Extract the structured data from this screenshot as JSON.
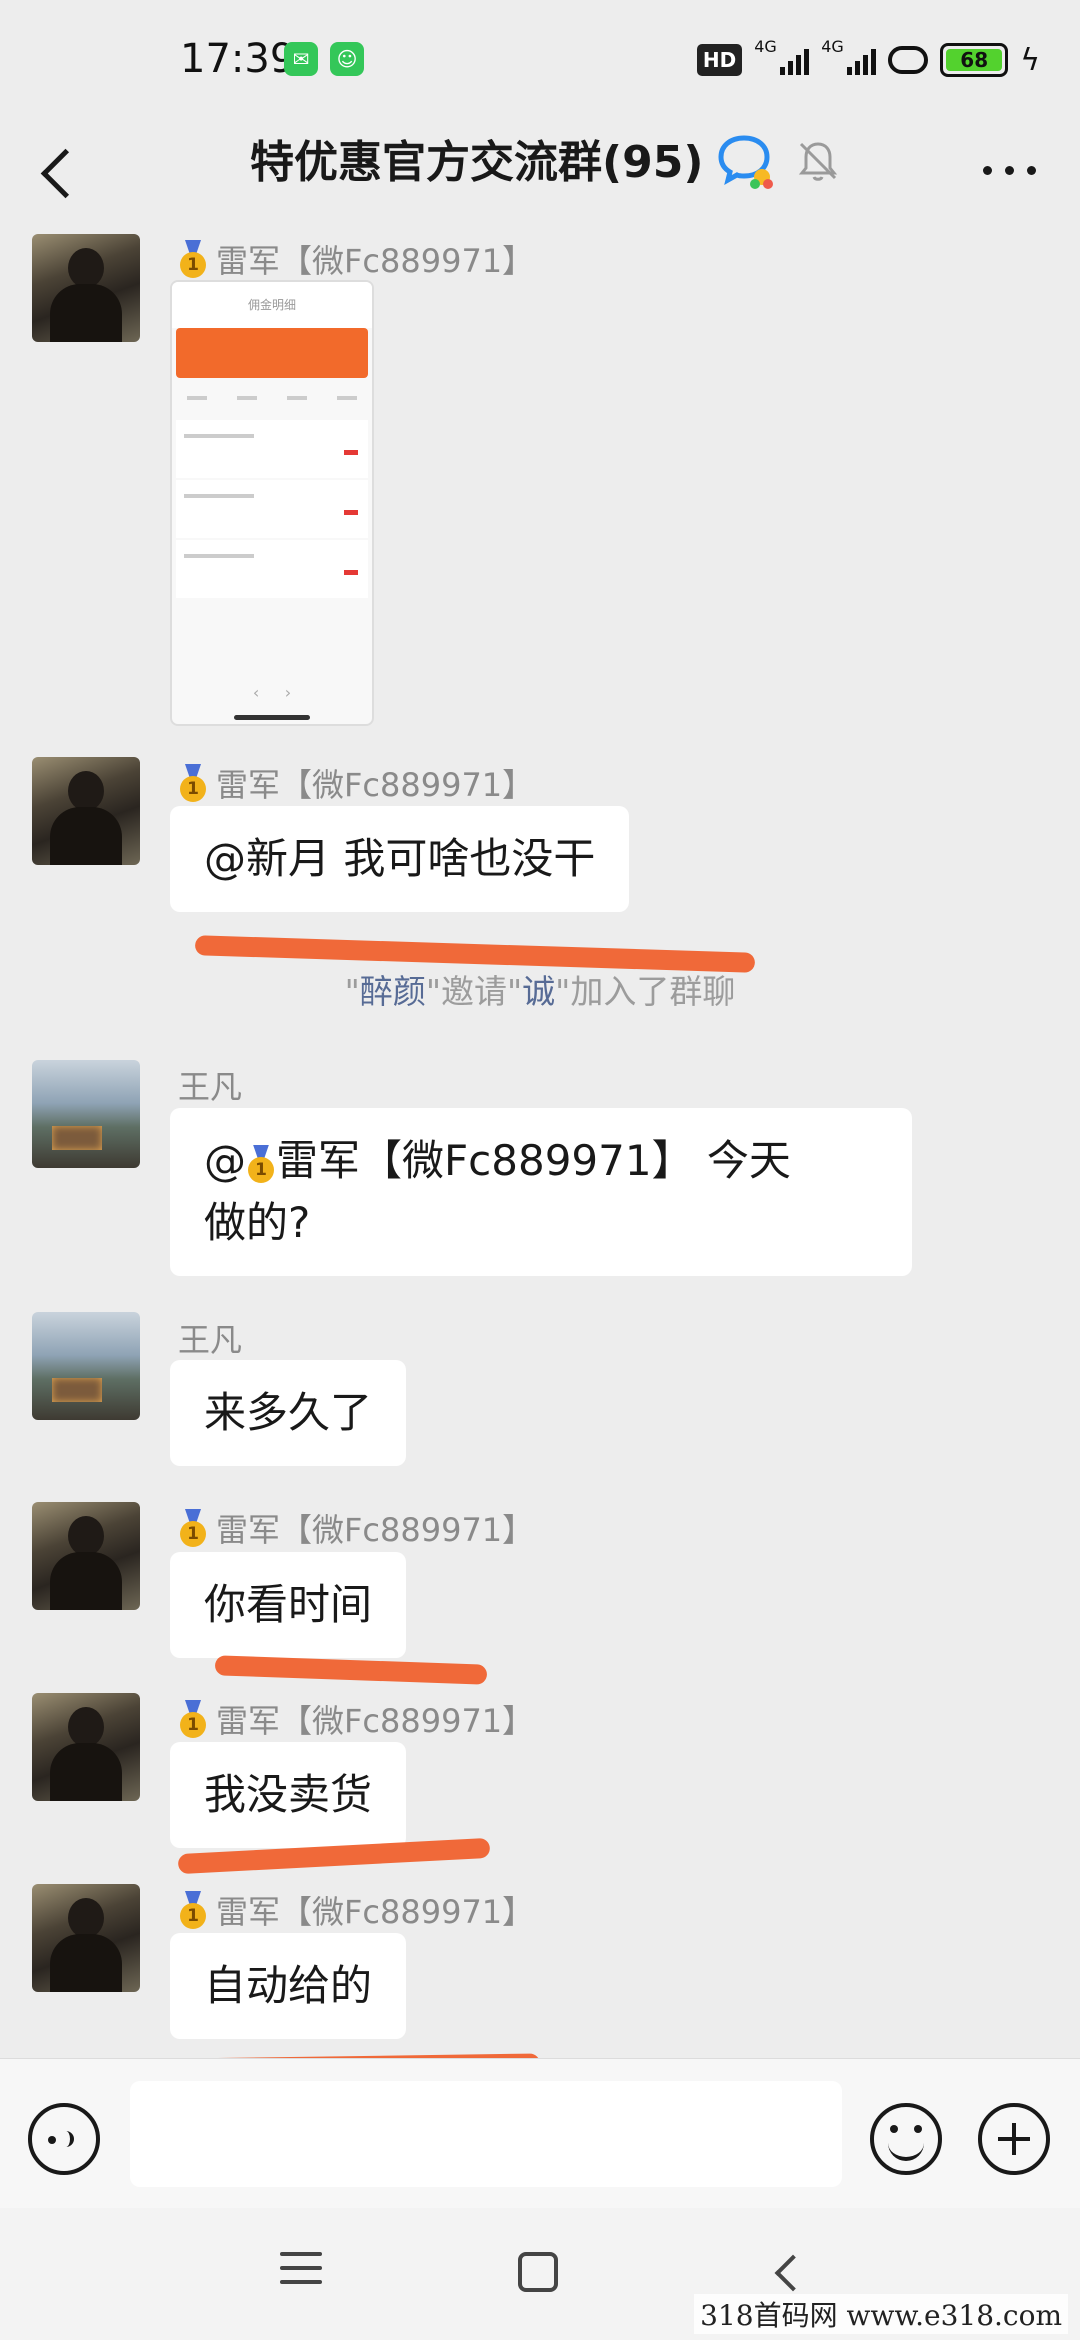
{
  "status_bar": {
    "time": "17:39",
    "hd_label": "HD",
    "network_1": "4G",
    "network_2": "4G",
    "battery_level": "68"
  },
  "header": {
    "title": "特优惠官方交流群(95)"
  },
  "senders": {
    "lei": "雷军【微Fc889971】",
    "wang": "王凡"
  },
  "messages": [
    {
      "sender": "lei",
      "type": "image",
      "image_title": "佣金明细"
    },
    {
      "sender": "lei",
      "type": "text",
      "text": "@新月  我可啥也没干"
    },
    {
      "sender": "wang",
      "type": "text",
      "text_prefix": "@",
      "text_main": "雷军【微Fc889971】 今天",
      "text_line2": "做的?"
    },
    {
      "sender": "wang",
      "type": "text",
      "text": "来多久了"
    },
    {
      "sender": "lei",
      "type": "text",
      "text": "你看时间"
    },
    {
      "sender": "lei",
      "type": "text",
      "text": "我没卖货"
    },
    {
      "sender": "lei",
      "type": "text",
      "text": "自动给的"
    }
  ],
  "system_message": {
    "quote_open": "\"",
    "inviter": "醉颜",
    "mid": "\"邀请\"",
    "invitee": "诚",
    "tail": "\"加入了群聊"
  },
  "input": {
    "placeholder": ""
  },
  "watermark": "318首码网  www.e318.com",
  "colors": {
    "bubble": "#ffffff",
    "background": "#ededed",
    "scribble": "#f0622f",
    "link": "#576b95"
  }
}
